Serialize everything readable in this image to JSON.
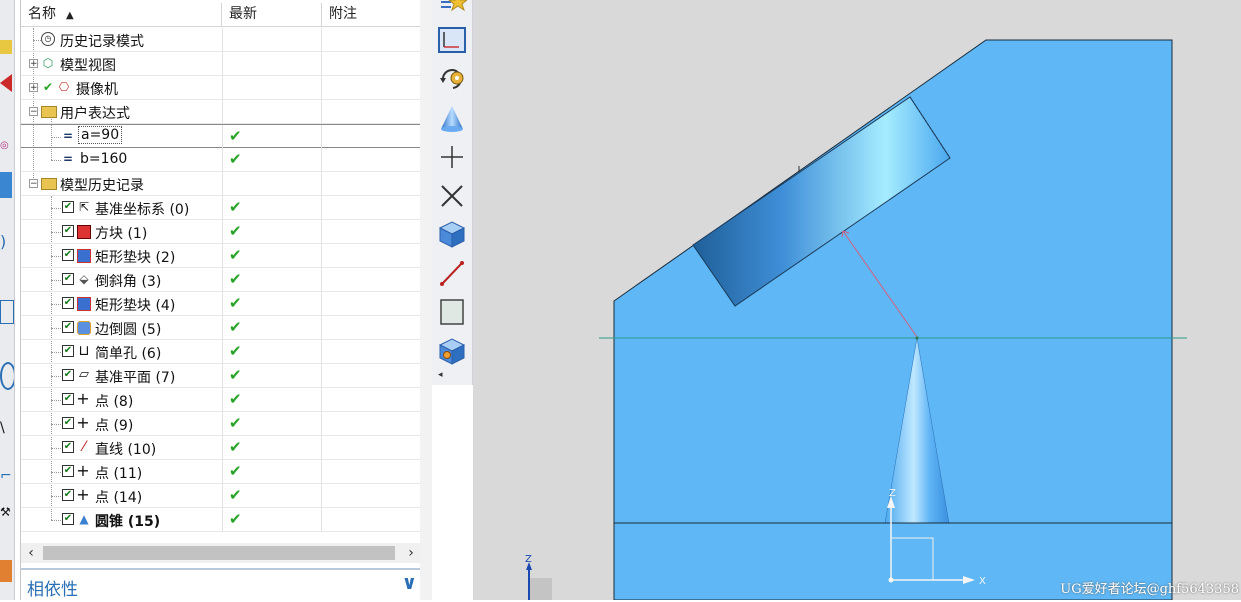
{
  "navigator": {
    "columns": {
      "name": "名称",
      "latest": "最新",
      "note": "附注"
    },
    "rows": [
      {
        "label": "历史记录模式",
        "icon": "clock-icon",
        "latest": ""
      },
      {
        "label": "模型视图",
        "icon": "model-view-icon",
        "latest": ""
      },
      {
        "label": "摄像机",
        "icon": "camera-icon",
        "latest": ""
      },
      {
        "label": "用户表达式",
        "icon": "folder-icon",
        "latest": ""
      },
      {
        "label": "a=90",
        "icon": "expression-icon",
        "latest": "✔"
      },
      {
        "label": "b=160",
        "icon": "expression-icon",
        "latest": "✔"
      },
      {
        "label": "模型历史记录",
        "icon": "folder-icon",
        "latest": ""
      },
      {
        "label": "基准坐标系 (0)",
        "icon": "datum-csys-icon",
        "latest": "✔"
      },
      {
        "label": "方块 (1)",
        "icon": "block-icon",
        "latest": "✔"
      },
      {
        "label": "矩形垫块 (2)",
        "icon": "pad-icon",
        "latest": "✔"
      },
      {
        "label": "倒斜角 (3)",
        "icon": "chamfer-icon",
        "latest": "✔"
      },
      {
        "label": "矩形垫块 (4)",
        "icon": "pad-icon",
        "latest": "✔"
      },
      {
        "label": "边倒圆 (5)",
        "icon": "edge-blend-icon",
        "latest": "✔"
      },
      {
        "label": "简单孔 (6)",
        "icon": "hole-icon",
        "latest": "✔"
      },
      {
        "label": "基准平面 (7)",
        "icon": "datum-plane-icon",
        "latest": "✔"
      },
      {
        "label": "点 (8)",
        "icon": "point-icon",
        "latest": "✔"
      },
      {
        "label": "点 (9)",
        "icon": "point-icon",
        "latest": "✔"
      },
      {
        "label": "直线 (10)",
        "icon": "line-icon",
        "latest": "✔"
      },
      {
        "label": "点 (11)",
        "icon": "point-icon",
        "latest": "✔"
      },
      {
        "label": "点 (14)",
        "icon": "point-icon",
        "latest": "✔"
      },
      {
        "label": "圆锥 (15)",
        "icon": "cone-icon",
        "latest": "✔"
      }
    ],
    "dependency_label": "相依性"
  },
  "toolbar": {
    "items": [
      "star-menu-icon",
      "csys-icon",
      "rotate-gear-icon",
      "cone-icon",
      "point-icon",
      "cross-icon",
      "block-icon",
      "line-icon",
      "plane-icon",
      "hole-block-icon",
      "more-icon"
    ]
  },
  "viewport": {
    "background": "#d9d9d9",
    "part_color": "#5fb8f5",
    "axis_z": "Z",
    "axis_x": "X",
    "triad_z": "Z",
    "watermark": "UG爱好者论坛@ghf5643358"
  }
}
